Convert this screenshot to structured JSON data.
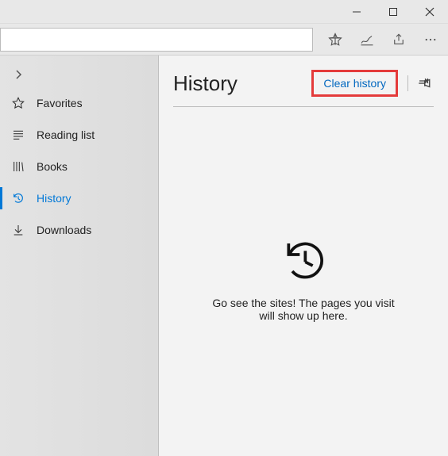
{
  "toolbar": {
    "address_value": ""
  },
  "sidebar": {
    "items": [
      {
        "label": "Favorites"
      },
      {
        "label": "Reading list"
      },
      {
        "label": "Books"
      },
      {
        "label": "History"
      },
      {
        "label": "Downloads"
      }
    ]
  },
  "main": {
    "title": "History",
    "clear_label": "Clear history",
    "empty_line1": "Go see the sites! The pages you visit",
    "empty_line2": "will show up here."
  }
}
